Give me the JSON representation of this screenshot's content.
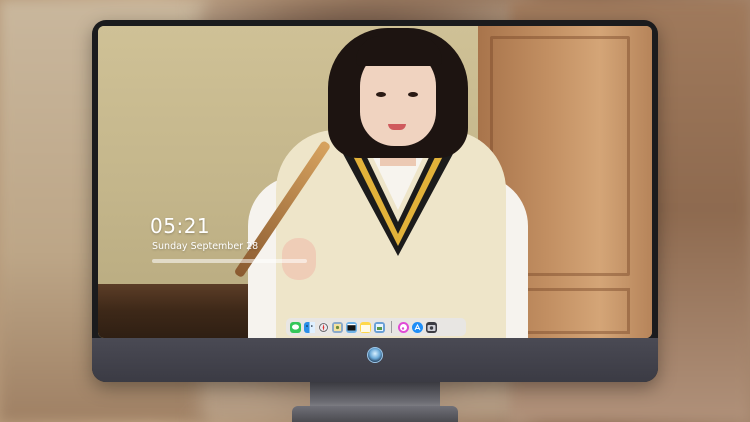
{
  "lock_screen": {
    "time": "05:21",
    "date": "Sunday September  28"
  },
  "dock": {
    "apps": [
      {
        "name": "messages-icon",
        "color": "#34c759"
      },
      {
        "name": "finder-icon",
        "color": "#2b8fe8"
      },
      {
        "name": "safari-icon",
        "color": "#e9e9ee"
      },
      {
        "name": "photo-app-icon",
        "color": "#8aa9c9"
      },
      {
        "name": "video-app-icon",
        "color": "#6fb2e6"
      },
      {
        "name": "notes-icon",
        "color": "#ffd84a"
      },
      {
        "name": "preview-icon",
        "color": "#6aa0d6"
      },
      {
        "name": "itunes-icon",
        "color": "#e04bd6"
      },
      {
        "name": "app-store-icon",
        "color": "#1e8ef7"
      },
      {
        "name": "camera-icon",
        "color": "#3b3b42"
      }
    ]
  },
  "colors": {
    "monitor_bezel": "#1b1b1d",
    "monitor_chin": "#3b3b44",
    "dock_background": "#e6e6eb"
  }
}
